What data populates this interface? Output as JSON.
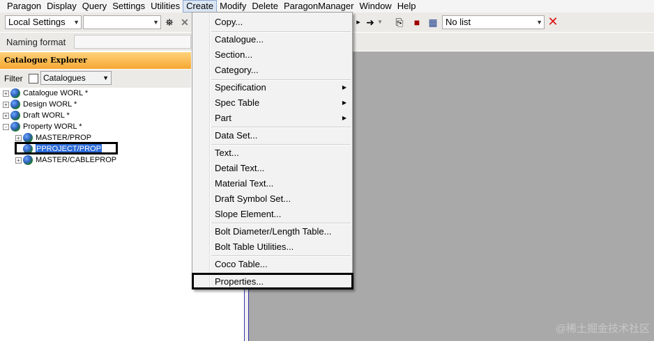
{
  "menubar": {
    "items": [
      "Paragon",
      "Display",
      "Query",
      "Settings",
      "Utilities",
      "Create",
      "Modify",
      "Delete",
      "ParagonManager",
      "Window",
      "Help"
    ]
  },
  "toolbar": {
    "settings_combo": "Local Settings",
    "empty_combo": "",
    "list_combo": "No list"
  },
  "naming": {
    "label": "Naming format",
    "value": ""
  },
  "explorer": {
    "title": "Catalogue Explorer",
    "filter_label": "Filter",
    "filter_combo": "Catalogues",
    "tree": [
      {
        "label": "Catalogue WORL *",
        "expander": "+"
      },
      {
        "label": "Design WORL *",
        "expander": "+"
      },
      {
        "label": "Draft WORL *",
        "expander": "+"
      },
      {
        "label": "Property WORL *",
        "expander": "-"
      },
      {
        "label": "MASTER/PROP",
        "expander": "+"
      },
      {
        "label": "PPROJECT/PROP",
        "expander": ""
      },
      {
        "label": "MASTER/CABLEPROP",
        "expander": "+"
      }
    ]
  },
  "create_menu": {
    "items": [
      "Copy...",
      "Catalogue...",
      "Section...",
      "Category...",
      "Specification",
      "Spec Table",
      "Part",
      "Data Set...",
      "Text...",
      "Detail Text...",
      "Material Text...",
      "Draft Symbol Set...",
      "Slope Element...",
      "Bolt Diameter/Length Table...",
      "Bolt Table Utilities...",
      "Coco Table...",
      "Properties..."
    ]
  },
  "watermark": "@稀土掘金技术社区",
  "colors": {
    "selection": "#2b6bd6",
    "explorer_title": "#f6a733",
    "workspace": "#a9a9a9"
  }
}
